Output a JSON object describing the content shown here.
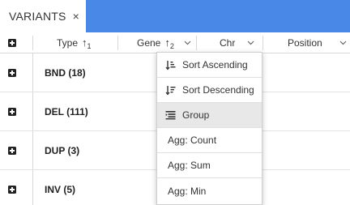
{
  "tab": {
    "title": "VARIANTS",
    "close": "×"
  },
  "header": {
    "columns": [
      {
        "label": "Type",
        "sort_arrow": "↑",
        "sort_index": "1"
      },
      {
        "label": "Gene",
        "sort_arrow": "↑",
        "sort_index": "2"
      },
      {
        "label": "Chr"
      },
      {
        "label": "Position"
      }
    ]
  },
  "rows": [
    {
      "label": "BND (18)"
    },
    {
      "label": "DEL (111)"
    },
    {
      "label": "DUP (3)"
    },
    {
      "label": "INV (5)"
    }
  ],
  "menu": {
    "items": [
      {
        "label": "Sort Ascending",
        "icon": "sort-ascending-icon"
      },
      {
        "label": "Sort Descending",
        "icon": "sort-descending-icon"
      },
      {
        "label": "Group",
        "icon": "group-icon",
        "highlighted": true
      },
      {
        "label": "Agg: Count"
      },
      {
        "label": "Agg: Sum"
      },
      {
        "label": "Agg: Min"
      }
    ]
  }
}
